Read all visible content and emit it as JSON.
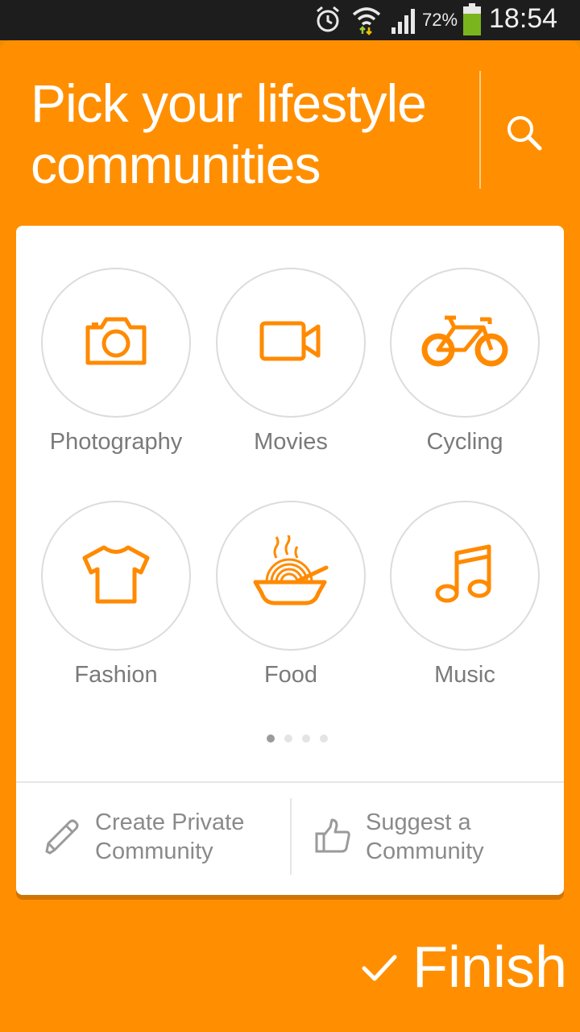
{
  "status_bar": {
    "icons": [
      "alarm-icon",
      "wifi-icon",
      "signal-icon",
      "battery-icon"
    ],
    "battery_percent": "72%",
    "time": "18:54"
  },
  "header": {
    "title": "Pick your lifestyle communities",
    "search_icon": "search-icon"
  },
  "categories": [
    {
      "label": "Photography",
      "icon": "camera-icon"
    },
    {
      "label": "Movies",
      "icon": "video-camera-icon"
    },
    {
      "label": "Cycling",
      "icon": "bicycle-icon"
    },
    {
      "label": "Fashion",
      "icon": "t-shirt-icon"
    },
    {
      "label": "Food",
      "icon": "noodle-bowl-icon"
    },
    {
      "label": "Music",
      "icon": "music-note-icon"
    }
  ],
  "pagination": {
    "pages": 4,
    "current": 1
  },
  "actions": {
    "create_private": "Create Private Community",
    "suggest": "Suggest a Community"
  },
  "finish": {
    "label": "Finish"
  },
  "colors": {
    "accent": "#ff8f00",
    "icon_orange": "#ff8a00",
    "label_gray": "#7a7a7a"
  }
}
